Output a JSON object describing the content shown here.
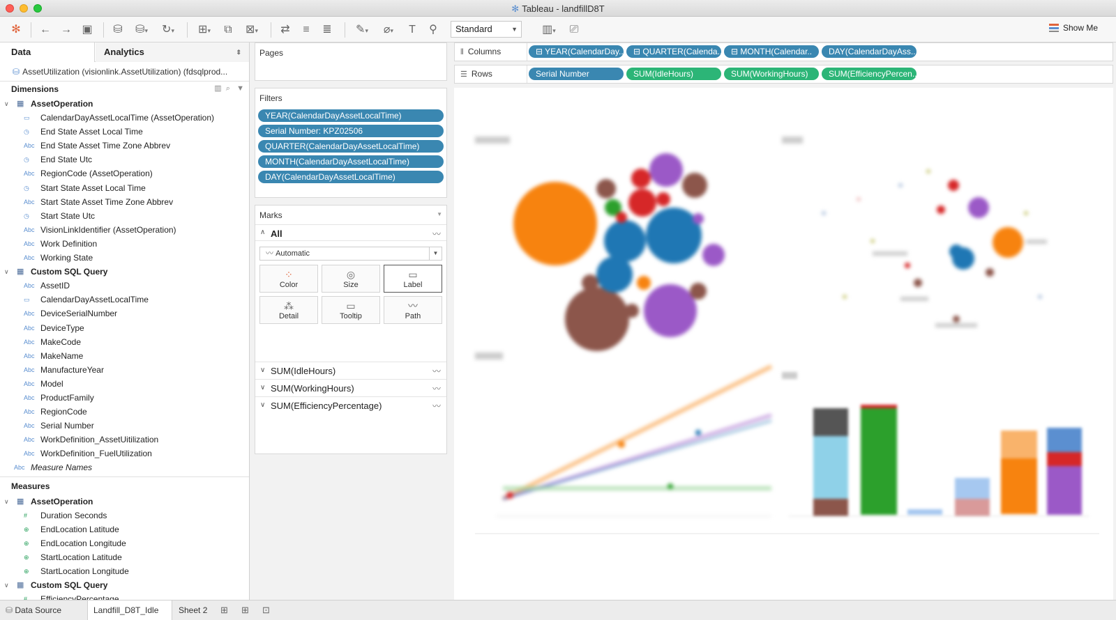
{
  "window": {
    "title": "Tableau - landfillD8T"
  },
  "toolbar": {
    "mark_size_select": "Standard",
    "show_me_label": "Show Me"
  },
  "data_pane": {
    "tab_data": "Data",
    "tab_analytics": "Analytics",
    "datasource": "AssetUtilization (visionlink.AssetUtilization) (fdsqlprod...",
    "dimensions_label": "Dimensions",
    "measures_label": "Measures",
    "dimension_groups": [
      {
        "name": "AssetOperation",
        "fields": [
          {
            "type": "date",
            "name": "CalendarDayAssetLocalTime (AssetOperation)"
          },
          {
            "type": "datetime",
            "name": "End State Asset Local Time"
          },
          {
            "type": "Abc",
            "name": "End State Asset Time Zone Abbrev"
          },
          {
            "type": "datetime",
            "name": "End State Utc"
          },
          {
            "type": "Abc",
            "name": "RegionCode (AssetOperation)"
          },
          {
            "type": "datetime",
            "name": "Start State Asset Local Time"
          },
          {
            "type": "Abc",
            "name": "Start State Asset Time Zone Abbrev"
          },
          {
            "type": "datetime",
            "name": "Start State Utc"
          },
          {
            "type": "Abc",
            "name": "VisionLinkIdentifier (AssetOperation)"
          },
          {
            "type": "Abc",
            "name": "Work Definition"
          },
          {
            "type": "Abc",
            "name": "Working State"
          }
        ]
      },
      {
        "name": "Custom SQL Query",
        "fields": [
          {
            "type": "Abc",
            "name": "AssetID"
          },
          {
            "type": "date",
            "name": "CalendarDayAssetLocalTime"
          },
          {
            "type": "Abc",
            "name": "DeviceSerialNumber"
          },
          {
            "type": "Abc",
            "name": "DeviceType"
          },
          {
            "type": "Abc",
            "name": "MakeCode"
          },
          {
            "type": "Abc",
            "name": "MakeName"
          },
          {
            "type": "Abc",
            "name": "ManufactureYear"
          },
          {
            "type": "Abc",
            "name": "Model"
          },
          {
            "type": "Abc",
            "name": "ProductFamily"
          },
          {
            "type": "Abc",
            "name": "RegionCode"
          },
          {
            "type": "Abc",
            "name": "Serial Number"
          },
          {
            "type": "Abc",
            "name": "WorkDefinition_AssetUitilization"
          },
          {
            "type": "Abc",
            "name": "WorkDefinition_FuelUtilization"
          }
        ]
      }
    ],
    "measure_names": "Measure Names",
    "measure_groups": [
      {
        "name": "AssetOperation",
        "fields": [
          {
            "type": "#",
            "name": "Duration Seconds"
          },
          {
            "type": "geo",
            "name": "EndLocation Latitude"
          },
          {
            "type": "geo",
            "name": "EndLocation Longitude"
          },
          {
            "type": "geo",
            "name": "StartLocation Latitude"
          },
          {
            "type": "geo",
            "name": "StartLocation Longitude"
          }
        ]
      },
      {
        "name": "Custom SQL Query",
        "fields": [
          {
            "type": "#",
            "name": "EfficiencyPercentage"
          }
        ]
      }
    ]
  },
  "pages": {
    "label": "Pages"
  },
  "filters": {
    "label": "Filters",
    "items": [
      "YEAR(CalendarDayAssetLocalTime)",
      "Serial Number: KPZ02506",
      "QUARTER(CalendarDayAssetLocalTime)",
      "MONTH(CalendarDayAssetLocalTime)",
      "DAY(CalendarDayAssetLocalTime)"
    ]
  },
  "marks": {
    "label": "Marks",
    "all_label": "All",
    "mark_type": "Automatic",
    "buttons": [
      "Color",
      "Size",
      "Label",
      "Detail",
      "Tooltip",
      "Path"
    ],
    "shelves": [
      "SUM(IdleHours)",
      "SUM(WorkingHours)",
      "SUM(EfficiencyPercentage)"
    ]
  },
  "columns": {
    "label": "Columns",
    "pills": [
      "YEAR(CalendarDay..",
      "QUARTER(Calenda..",
      "MONTH(Calendar..",
      "DAY(CalendarDayAss.."
    ]
  },
  "rows": {
    "label": "Rows",
    "pills": [
      "Serial Number",
      "SUM(IdleHours)",
      "SUM(WorkingHours)",
      "SUM(EfficiencyPercen.."
    ]
  },
  "sheet_tabs": {
    "data_source": "Data Source",
    "active": "Landfill_D8T_Idle",
    "other": "Sheet 2"
  },
  "colors": {
    "pill_blue": "#3a87b1",
    "pill_green": "#2cb577",
    "orange": "#f7830f",
    "blue": "#1f77b4",
    "purple": "#9b59c7",
    "brown": "#8c564b",
    "red": "#d62728",
    "green": "#2ca02c"
  }
}
